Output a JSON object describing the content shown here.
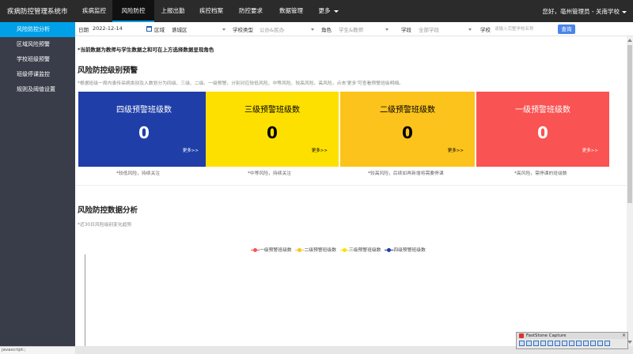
{
  "app": {
    "title": "疾病防控管理系统市"
  },
  "nav": {
    "items": [
      {
        "label": "疾病监控"
      },
      {
        "label": "风险防控"
      },
      {
        "label": "上报出勤"
      },
      {
        "label": "疾控档案"
      },
      {
        "label": "防控要求"
      },
      {
        "label": "数据管理"
      },
      {
        "label": "更多"
      }
    ],
    "active": "风险防控",
    "user": "您好，亳州管理员 - 关南学校"
  },
  "sidebar": {
    "items": [
      {
        "label": "风险防控分析"
      },
      {
        "label": "区域风险预警"
      },
      {
        "label": "学校班级预警"
      },
      {
        "label": "班级停课监控"
      },
      {
        "label": "规则及阈值设置"
      }
    ]
  },
  "filters": {
    "date_label": "日期",
    "date_value": "2022-12-14",
    "region_label": "区域",
    "region_value": "谯城区",
    "school_type_label": "学校类型",
    "school_type_value": "公办&民办",
    "role_label": "角色",
    "role_value": "学生&教师",
    "section_label": "学段",
    "section_value": "全部学段",
    "school_label": "学校",
    "school_placeholder": "请输入完整学校名称",
    "query_button": "查询"
  },
  "main": {
    "note": "*当前数据为教师与学生数据之和可在上方选择数据呈现角色",
    "warning_section": {
      "title": "风险防控级别预警",
      "desc": "*根据班级一周内患传染病类别及人数划分为四级、三级、二级、一级预警，分别对应较低风险、中等风险、较高风险、高风险，点击'更多'可查看预警班级明细。"
    },
    "cards": [
      {
        "title": "四级预警班级数",
        "value": "0",
        "more": "更多>>",
        "note": "*较低风险，持续关注",
        "color": "#1f3ea8",
        "text_color": "#ffffff"
      },
      {
        "title": "三级预警班级数",
        "value": "0",
        "more": "更多>>",
        "note": "*中等风险，持续关注",
        "color": "#fde000",
        "text_color": "#000000"
      },
      {
        "title": "二级预警班级数",
        "value": "0",
        "more": "更多>>",
        "note": "*较高风险，后续如再新增将需要停课",
        "color": "#fcc31c",
        "text_color": "#000000"
      },
      {
        "title": "一级预警班级数",
        "value": "0",
        "more": "更多>>",
        "note": "*高风险，需停课的班级数",
        "color": "#f95353",
        "text_color": "#ffffff"
      }
    ],
    "analysis_section": {
      "title": "风险防控数据分析",
      "desc": "*近30日风险级别变化趋势"
    },
    "legend": [
      {
        "label": "一级预警班级数",
        "color": "#f95353"
      },
      {
        "label": "二级预警班级数",
        "color": "#fcc31c"
      },
      {
        "label": "三级预警班级数",
        "color": "#fde000"
      },
      {
        "label": "四级预警班级数",
        "color": "#1f3ea8"
      }
    ]
  },
  "statusbar": {
    "text": "javascript:;"
  },
  "faststone": {
    "title": "FastStone Capture",
    "close": "×"
  }
}
